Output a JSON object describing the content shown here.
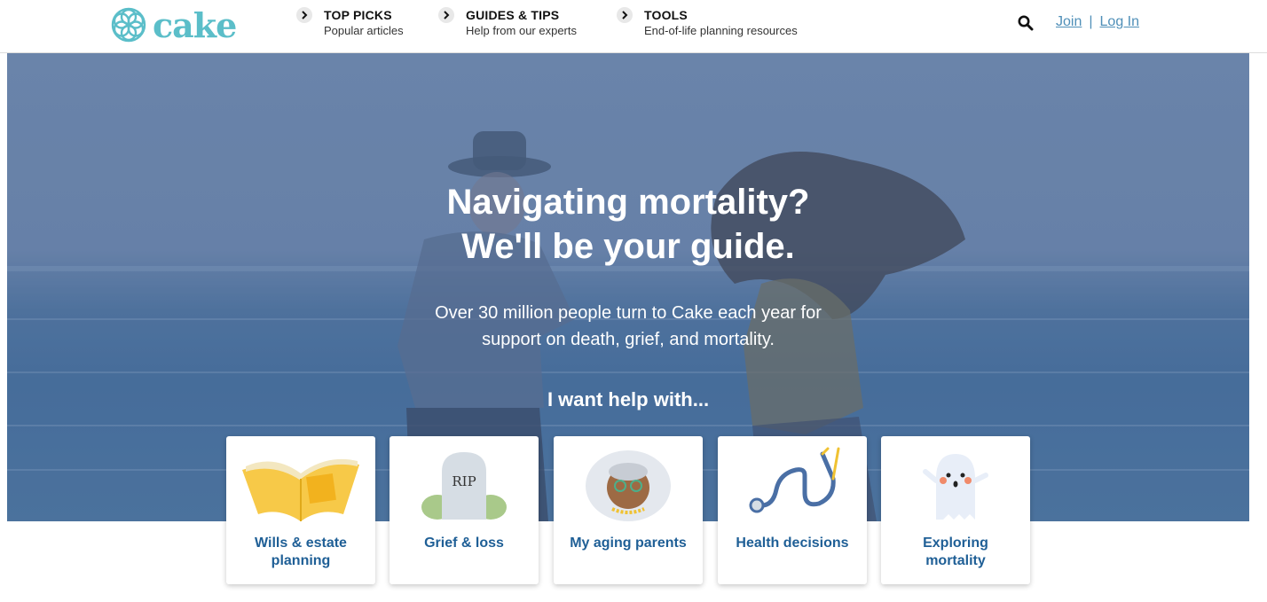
{
  "header": {
    "logo_text": "cake",
    "nav": [
      {
        "title": "TOP PICKS",
        "subtitle": "Popular articles"
      },
      {
        "title": "GUIDES & TIPS",
        "subtitle": "Help from our experts"
      },
      {
        "title": "TOOLS",
        "subtitle": "End-of-life planning resources"
      }
    ],
    "join_label": "Join",
    "separator": "|",
    "login_label": "Log In"
  },
  "hero": {
    "title_line1": "Navigating mortality?",
    "title_line2": "We'll be your guide.",
    "subtitle_line1": "Over 30 million people turn to Cake each year for",
    "subtitle_line2": "support on death, grief, and mortality.",
    "help_prompt": "I want help with..."
  },
  "cards": [
    {
      "label_line1": "Wills & estate",
      "label_line2": "planning",
      "icon": "book-icon"
    },
    {
      "label_line1": "Grief & loss",
      "label_line2": "",
      "icon": "tombstone-icon",
      "icon_text": "RIP"
    },
    {
      "label_line1": "My aging parents",
      "label_line2": "",
      "icon": "grandma-icon"
    },
    {
      "label_line1": "Health decisions",
      "label_line2": "",
      "icon": "stethoscope-icon"
    },
    {
      "label_line1": "Exploring",
      "label_line2": "mortality",
      "icon": "ghost-icon"
    }
  ],
  "colors": {
    "brand": "#5bbec9",
    "link": "#4f8fb8",
    "card_label": "#1f5f96"
  }
}
